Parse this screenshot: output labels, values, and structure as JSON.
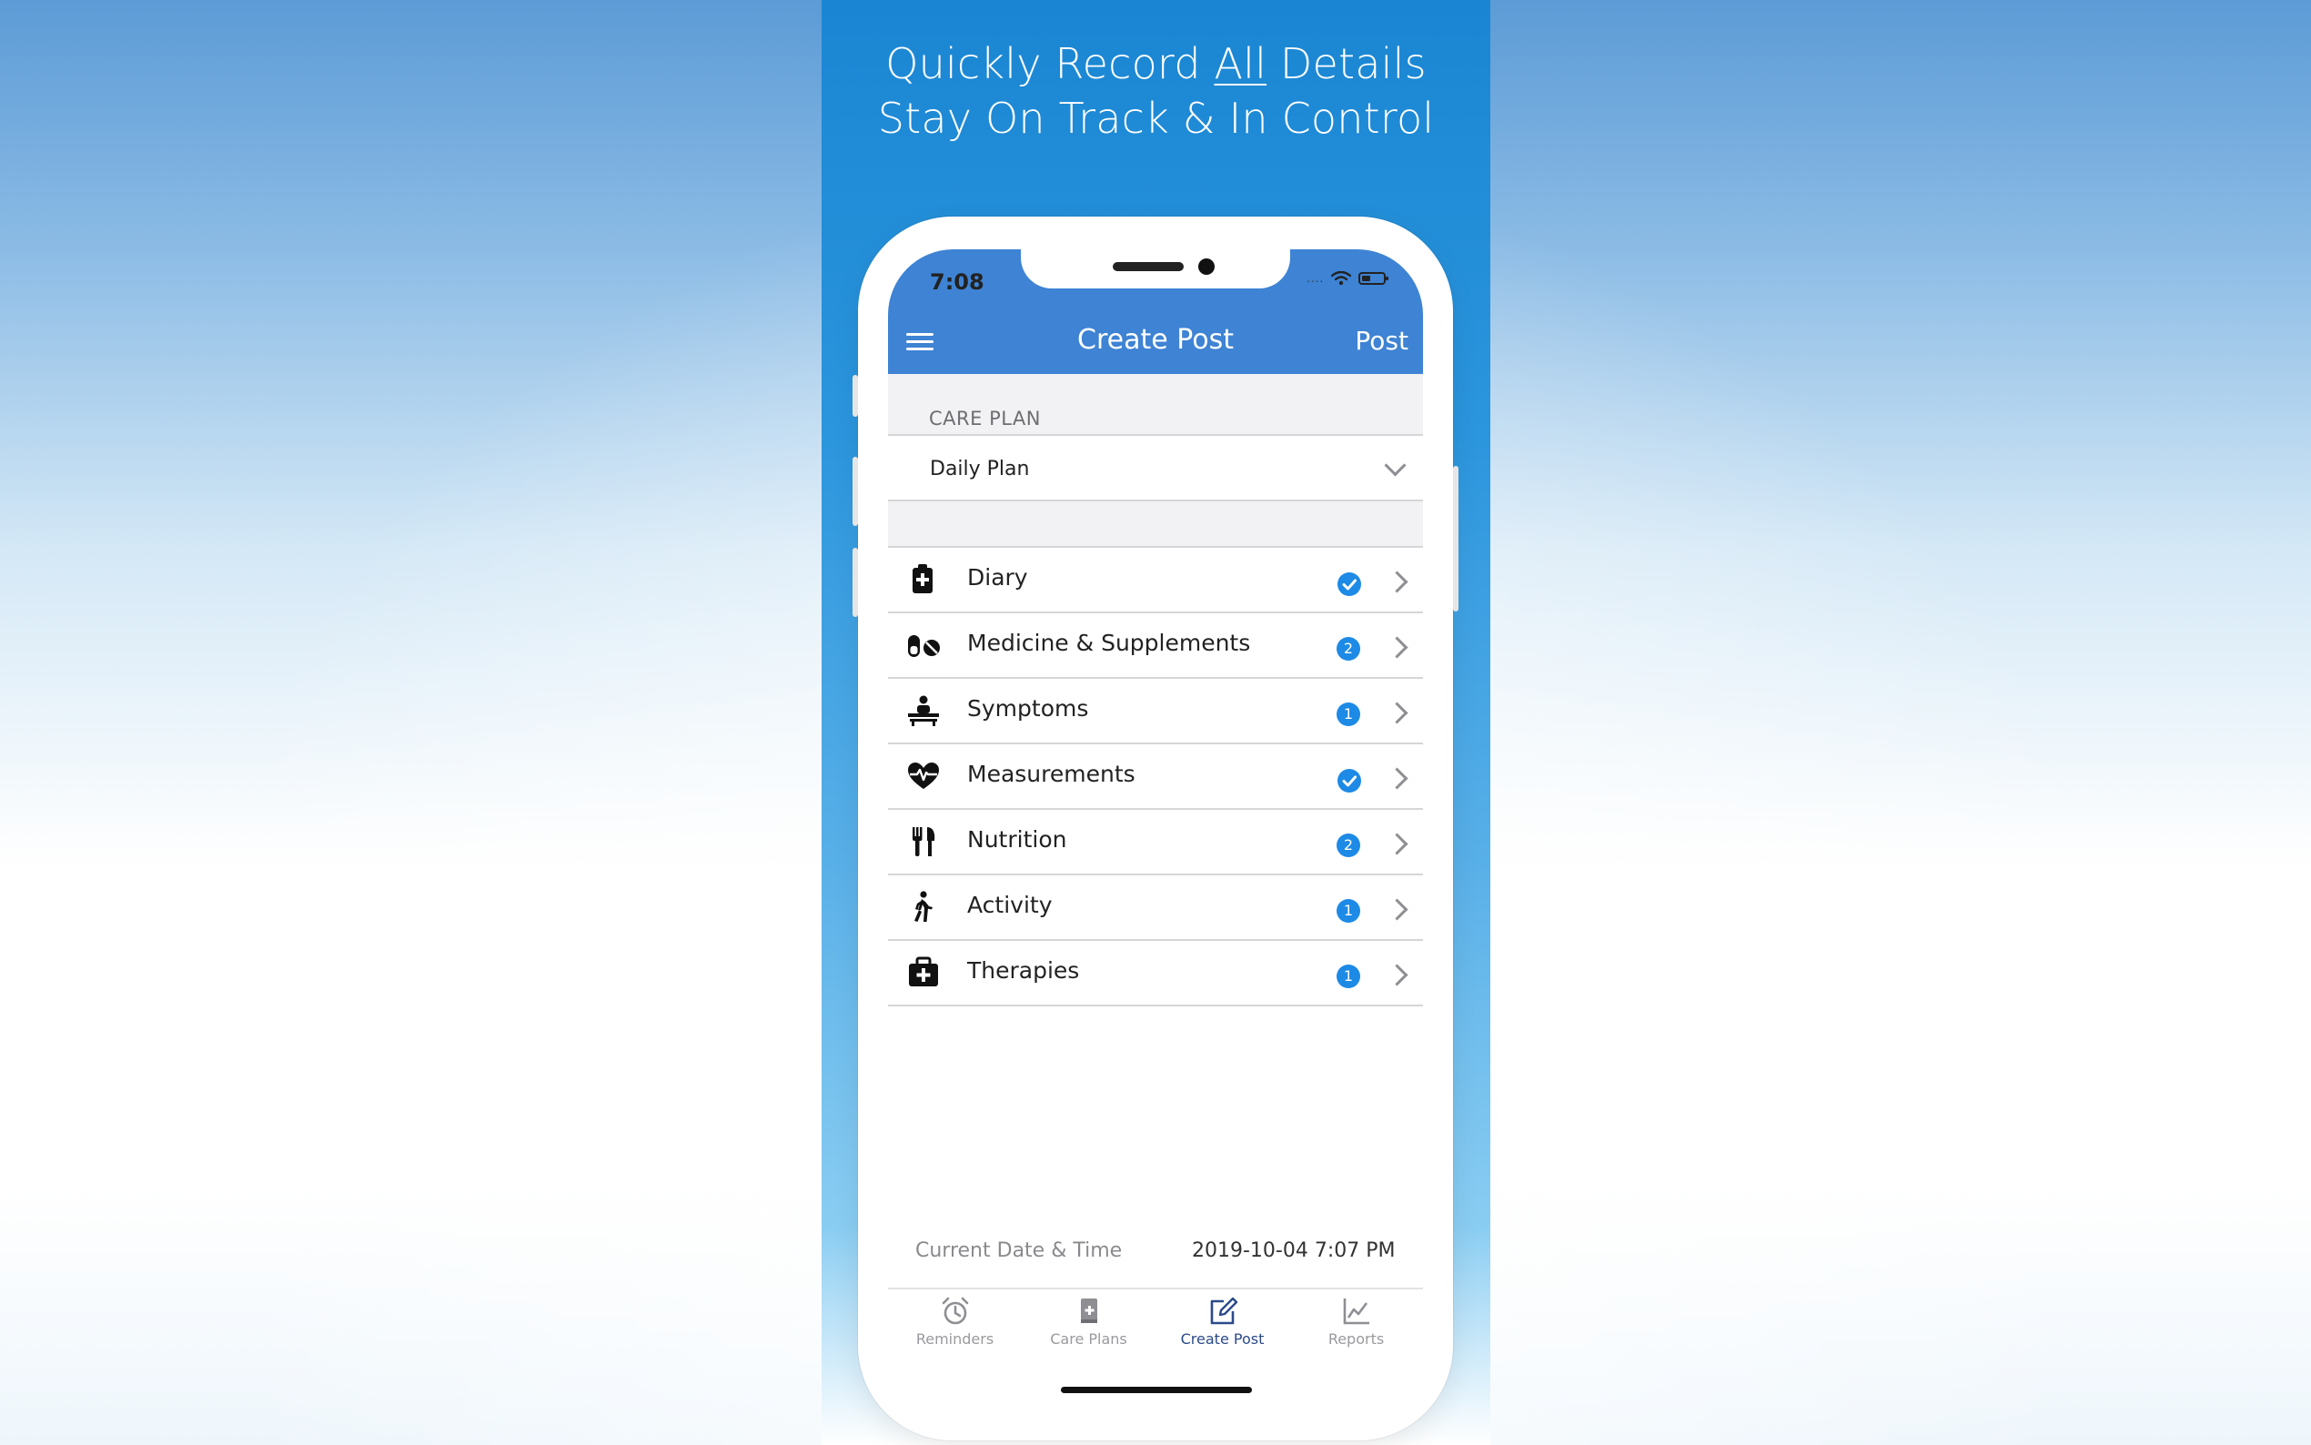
{
  "marketing": {
    "headline_line1_a": "Quickly Record ",
    "headline_line1_b": "All",
    "headline_line1_c": " Details",
    "headline_line2": "Stay On Track & In Control"
  },
  "status_bar": {
    "time": "7:08",
    "signal": "....",
    "icons": [
      "wifi-icon",
      "battery-icon"
    ]
  },
  "navbar": {
    "title": "Create Post",
    "action_label": "Post",
    "menu_icon": "hamburger-menu-icon"
  },
  "care_plan": {
    "section_label": "CARE PLAN",
    "selected": "Daily Plan"
  },
  "categories": [
    {
      "label": "Diary",
      "icon": "clipboard-plus-icon",
      "status": "check"
    },
    {
      "label": "Medicine & Supplements",
      "icon": "pills-icon",
      "status": "2"
    },
    {
      "label": "Symptoms",
      "icon": "patient-bed-icon",
      "status": "1"
    },
    {
      "label": "Measurements",
      "icon": "heartbeat-icon",
      "status": "check"
    },
    {
      "label": "Nutrition",
      "icon": "utensils-icon",
      "status": "2"
    },
    {
      "label": "Activity",
      "icon": "walking-icon",
      "status": "1"
    },
    {
      "label": "Therapies",
      "icon": "medkit-icon",
      "status": "1"
    }
  ],
  "datetime": {
    "label": "Current Date & Time",
    "value": "2019-10-04 7:07 PM"
  },
  "tabs": [
    {
      "label": "Reminders",
      "icon": "alarm-clock-icon",
      "active": false
    },
    {
      "label": "Care Plans",
      "icon": "book-plus-icon",
      "active": false
    },
    {
      "label": "Create Post",
      "icon": "edit-icon",
      "active": true
    },
    {
      "label": "Reports",
      "icon": "line-chart-icon",
      "active": false
    }
  ],
  "colors": {
    "appbar": "#3e83d4",
    "badge": "#1d8ae6",
    "active_tab": "#2a4a8a"
  }
}
